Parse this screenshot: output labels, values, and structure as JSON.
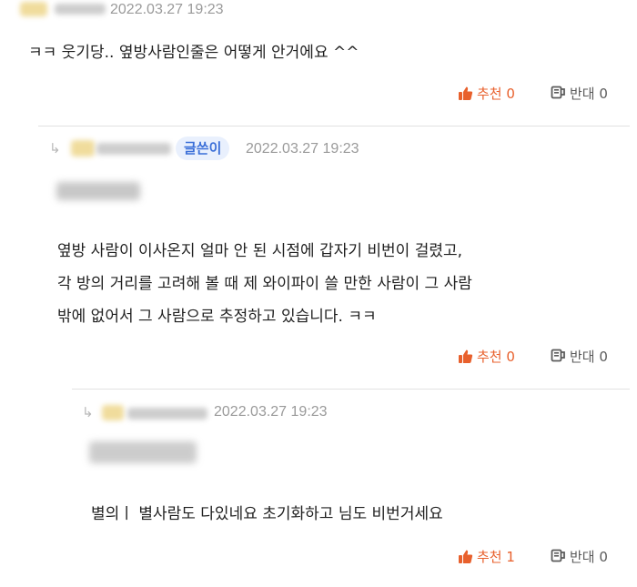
{
  "colors": {
    "accent_recommend": "#e8602c",
    "badge_bg": "#e9f0fd",
    "badge_text": "#3b6fd8",
    "meta_text": "#9a9a9a"
  },
  "comments": [
    {
      "timestamp": "2022.03.27 19:23",
      "lines": [
        "ㅋㅋ 웃기당.. 옆방사람인줄은 어떻게 안거에요 ^^"
      ],
      "recommend_label": "추천 0",
      "oppose_label": "반대 0"
    },
    {
      "badge": "글쓴이",
      "timestamp": "2022.03.27 19:23",
      "lines": [
        "옆방 사람이 이사온지 얼마 안 된 시점에 갑자기 비번이 걸렸고,",
        "각 방의 거리를 고려해 볼 때 제 와이파이 쓸 만한 사람이 그 사람",
        "밖에 없어서 그 사람으로 추정하고 있습니다.  ㅋㅋ"
      ],
      "recommend_label": "추천 0",
      "oppose_label": "반대 0"
    },
    {
      "timestamp": "2022.03.27 19:23",
      "lines": [
        "별의ㅣ  별사람도 다있네요 초기화하고 님도 비번거세요"
      ],
      "recommend_label": "추천 1",
      "oppose_label": "반대 0"
    }
  ],
  "icons": {
    "reply": "reply-arrow-icon",
    "recommend": "thumbs-up-icon",
    "oppose": "thumbs-down-icon"
  },
  "reply_arrow_glyph": "↳"
}
